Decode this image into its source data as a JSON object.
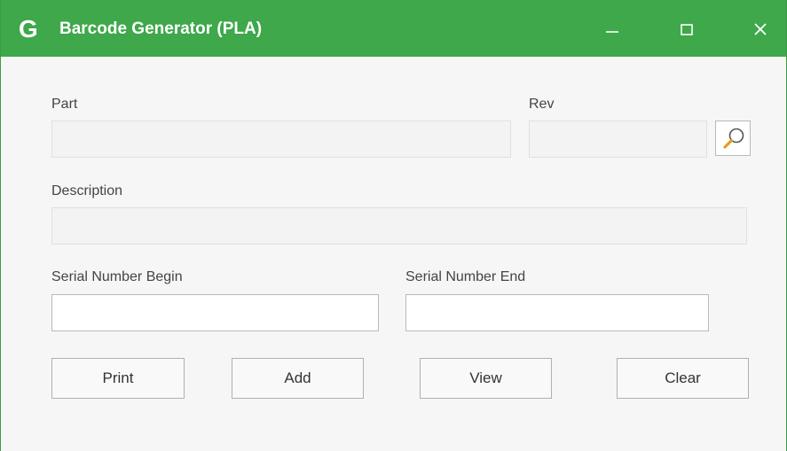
{
  "window": {
    "title": "Barcode Generator (PLA)",
    "logo_letter": "G",
    "accent_color": "#3ea84a",
    "controls": {
      "minimize_icon": "minimize-icon",
      "maximize_icon": "maximize-icon",
      "close_icon": "close-icon"
    }
  },
  "form": {
    "part": {
      "label": "Part",
      "value": ""
    },
    "rev": {
      "label": "Rev",
      "value": ""
    },
    "lookup_icon": "search-icon",
    "description": {
      "label": "Description",
      "value": ""
    },
    "serial_begin": {
      "label": "Serial Number Begin",
      "value": ""
    },
    "serial_end": {
      "label": "Serial Number End",
      "value": ""
    }
  },
  "actions": {
    "print": "Print",
    "add": "Add",
    "view": "View",
    "clear": "Clear"
  }
}
